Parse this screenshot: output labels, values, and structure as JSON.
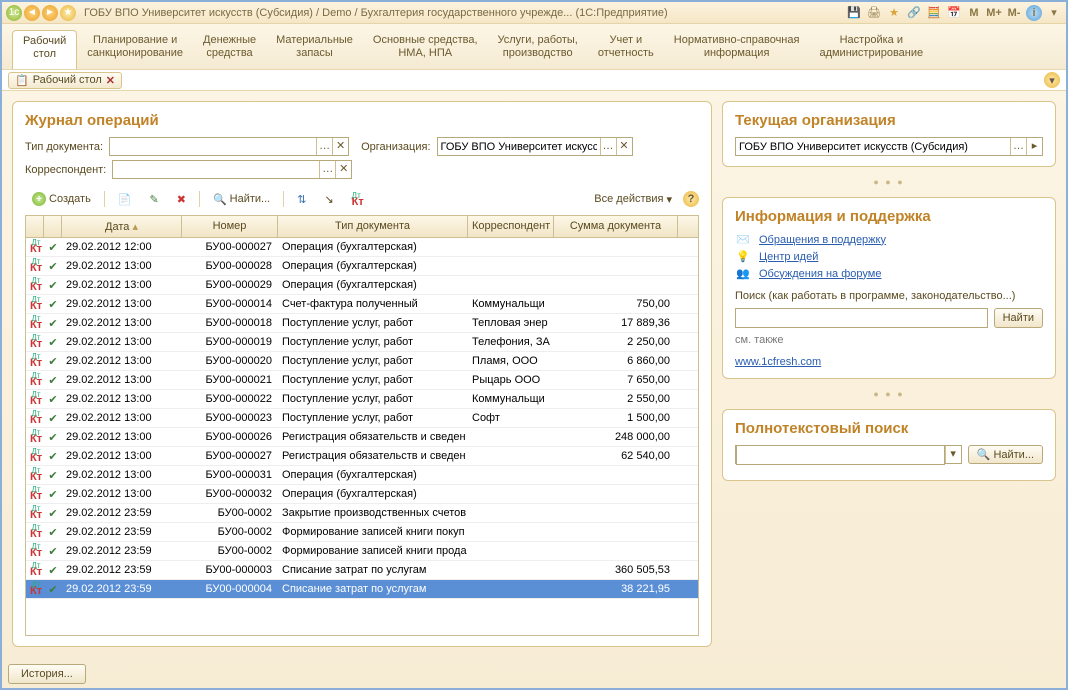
{
  "title": "ГОБУ ВПО Университет искусств (Субсидия) / Demo / Бухгалтерия государственного учрежде... (1С:Предприятие)",
  "mbuttons": [
    "M",
    "M+",
    "M-"
  ],
  "nav": [
    {
      "l1": "Рабочий",
      "l2": "стол"
    },
    {
      "l1": "Планирование и",
      "l2": "санкционирование"
    },
    {
      "l1": "Денежные",
      "l2": "средства"
    },
    {
      "l1": "Материальные",
      "l2": "запасы"
    },
    {
      "l1": "Основные средства,",
      "l2": "НМА, НПА"
    },
    {
      "l1": "Услуги, работы,",
      "l2": "производство"
    },
    {
      "l1": "Учет и",
      "l2": "отчетность"
    },
    {
      "l1": "Нормативно-справочная",
      "l2": "информация"
    },
    {
      "l1": "Настройка и",
      "l2": "администрирование"
    }
  ],
  "tab": "Рабочий стол",
  "journal": {
    "heading": "Журнал операций",
    "doctype_lbl": "Тип документа:",
    "org_lbl": "Организация:",
    "org_value": "ГОБУ ВПО Университет искусс",
    "corr_lbl": "Корреспондент:",
    "create": "Создать",
    "find": "Найти...",
    "all_actions": "Все действия",
    "cols": [
      "Дата",
      "Номер",
      "Тип документа",
      "Корреспондент",
      "Сумма документа"
    ],
    "rows": [
      {
        "d": "29.02.2012 12:00",
        "n": "БУ00-000027",
        "t": "Операция (бухгалтерская)",
        "c": "",
        "s": ""
      },
      {
        "d": "29.02.2012 13:00",
        "n": "БУ00-000028",
        "t": "Операция (бухгалтерская)",
        "c": "",
        "s": ""
      },
      {
        "d": "29.02.2012 13:00",
        "n": "БУ00-000029",
        "t": "Операция (бухгалтерская)",
        "c": "",
        "s": ""
      },
      {
        "d": "29.02.2012 13:00",
        "n": "БУ00-000014",
        "t": "Счет-фактура полученный",
        "c": "Коммунальщи",
        "s": "750,00"
      },
      {
        "d": "29.02.2012 13:00",
        "n": "БУ00-000018",
        "t": "Поступление услуг, работ",
        "c": "Тепловая энер",
        "s": "17 889,36"
      },
      {
        "d": "29.02.2012 13:00",
        "n": "БУ00-000019",
        "t": "Поступление услуг, работ",
        "c": "Телефония, ЗА",
        "s": "2 250,00"
      },
      {
        "d": "29.02.2012 13:00",
        "n": "БУ00-000020",
        "t": "Поступление услуг, работ",
        "c": "Пламя, ООО",
        "s": "6 860,00"
      },
      {
        "d": "29.02.2012 13:00",
        "n": "БУ00-000021",
        "t": "Поступление услуг, работ",
        "c": "Рыцарь ООО",
        "s": "7 650,00"
      },
      {
        "d": "29.02.2012 13:00",
        "n": "БУ00-000022",
        "t": "Поступление услуг, работ",
        "c": "Коммунальщи",
        "s": "2 550,00"
      },
      {
        "d": "29.02.2012 13:00",
        "n": "БУ00-000023",
        "t": "Поступление услуг, работ",
        "c": "Софт",
        "s": "1 500,00"
      },
      {
        "d": "29.02.2012 13:00",
        "n": "БУ00-000026",
        "t": "Регистрация обязательств и сведен",
        "c": "",
        "s": "248 000,00"
      },
      {
        "d": "29.02.2012 13:00",
        "n": "БУ00-000027",
        "t": "Регистрация обязательств и сведен",
        "c": "",
        "s": "62 540,00"
      },
      {
        "d": "29.02.2012 13:00",
        "n": "БУ00-000031",
        "t": "Операция (бухгалтерская)",
        "c": "",
        "s": ""
      },
      {
        "d": "29.02.2012 13:00",
        "n": "БУ00-000032",
        "t": "Операция (бухгалтерская)",
        "c": "",
        "s": ""
      },
      {
        "d": "29.02.2012 23:59",
        "n": "БУ00-0002",
        "t": "Закрытие производственных счетов",
        "c": "",
        "s": ""
      },
      {
        "d": "29.02.2012 23:59",
        "n": "БУ00-0002",
        "t": "Формирование записей книги покуп",
        "c": "",
        "s": ""
      },
      {
        "d": "29.02.2012 23:59",
        "n": "БУ00-0002",
        "t": "Формирование записей книги прода",
        "c": "",
        "s": ""
      },
      {
        "d": "29.02.2012 23:59",
        "n": "БУ00-000003",
        "t": "Списание затрат по услугам",
        "c": "",
        "s": "360 505,53"
      },
      {
        "d": "29.02.2012 23:59",
        "n": "БУ00-000004",
        "t": "Списание затрат по услугам",
        "c": "",
        "s": "38 221,95",
        "sel": true
      }
    ]
  },
  "org_panel": {
    "heading": "Текущая организация",
    "value": "ГОБУ ВПО Университет искусств (Субсидия)"
  },
  "info_panel": {
    "heading": "Информация и поддержка",
    "links": [
      "Обращения в поддержку",
      "Центр идей",
      "Обсуждения на форуме"
    ],
    "search_lbl": "Поиск (как работать в программе, законодательство...)",
    "find_btn": "Найти",
    "see_also": "см. также",
    "site": "www.1cfresh.com"
  },
  "fts_panel": {
    "heading": "Полнотекстовый поиск",
    "find": "Найти..."
  },
  "footer_btn": "История..."
}
